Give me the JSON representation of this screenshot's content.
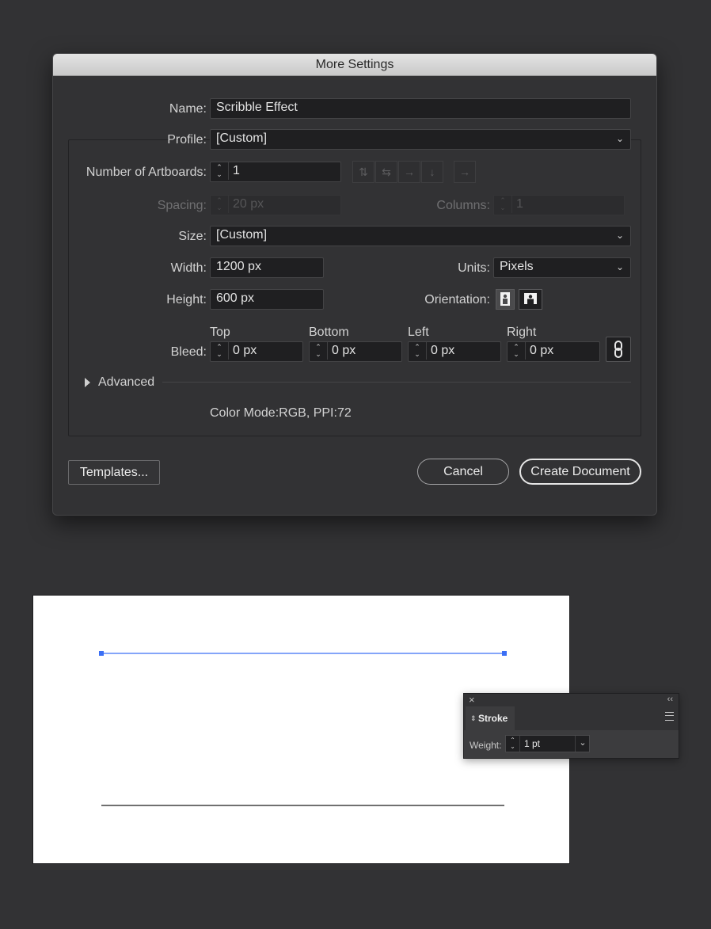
{
  "dialog": {
    "title": "More Settings",
    "name_label": "Name:",
    "name_value": "Scribble Effect",
    "profile_label": "Profile:",
    "profile_value": "[Custom]",
    "artboards_label": "Number of Artboards:",
    "artboards_value": "1",
    "spacing_label": "Spacing:",
    "spacing_value": "20 px",
    "columns_label": "Columns:",
    "columns_value": "1",
    "size_label": "Size:",
    "size_value": "[Custom]",
    "width_label": "Width:",
    "width_value": "1200 px",
    "units_label": "Units:",
    "units_value": "Pixels",
    "height_label": "Height:",
    "height_value": "600 px",
    "orientation_label": "Orientation:",
    "bleed_label": "Bleed:",
    "bleed": {
      "top_label": "Top",
      "top_value": "0 px",
      "bottom_label": "Bottom",
      "bottom_value": "0 px",
      "left_label": "Left",
      "left_value": "0 px",
      "right_label": "Right",
      "right_value": "0 px"
    },
    "advanced_label": "Advanced",
    "color_mode": "Color Mode:RGB, PPI:72",
    "templates_button": "Templates...",
    "cancel_button": "Cancel",
    "create_button": "Create Document"
  },
  "stroke_panel": {
    "tab_label": "Stroke",
    "weight_label": "Weight:",
    "weight_value": "1 pt"
  },
  "colors": {
    "selection_blue": "#3b6ff5",
    "background": "#323234"
  },
  "icons": [
    "chevron-down-icon",
    "stepper-arrows-icon",
    "grid-by-row-icon",
    "grid-by-column-icon",
    "arrange-by-row-icon",
    "arrange-by-column-icon",
    "right-to-left-icon",
    "portrait-icon",
    "landscape-icon",
    "link-icon",
    "disclosure-triangle-icon",
    "close-icon",
    "collapse-icon",
    "panel-menu-icon"
  ]
}
